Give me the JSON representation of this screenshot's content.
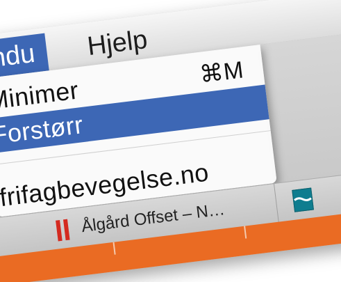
{
  "menubar": {
    "items": [
      {
        "label": "ndu"
      },
      {
        "label": "Hjelp"
      }
    ]
  },
  "dropdown": {
    "items": [
      {
        "label": "Minimer",
        "shortcut": "⌘M"
      },
      {
        "label": "Forstørr"
      },
      {
        "label": "frifagbevegelse.no"
      }
    ]
  },
  "tabbar": {
    "tabs": [
      {
        "label": "Ålgård Offset – N…",
        "icon": "pause-icon"
      }
    ],
    "next_tab_icon": "site-favicon-icon"
  },
  "colors": {
    "selection": "#3d67b5",
    "accent_orange": "#ea6b23",
    "pause_red": "#d42a20"
  }
}
